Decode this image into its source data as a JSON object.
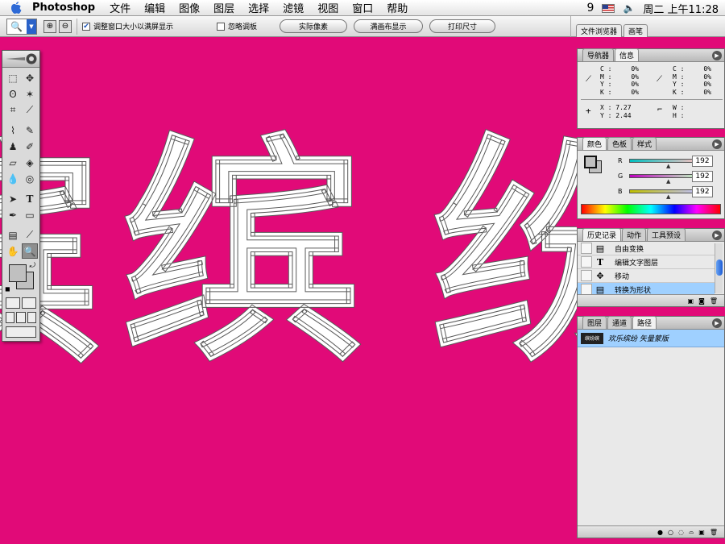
{
  "menubar": {
    "app_name": "Photoshop",
    "items": [
      "文件",
      "编辑",
      "图像",
      "图层",
      "选择",
      "滤镜",
      "视图",
      "窗口",
      "帮助"
    ],
    "status_icon": "9",
    "clock": "周二 上午11:28"
  },
  "options_bar": {
    "resize_windows_label": "调整窗口大小以满屏显示",
    "ignore_palettes_label": "忽略调板",
    "actual_pixels_button": "实际像素",
    "fit_on_screen_button": "满画布显示",
    "print_size_button": "打印尺寸",
    "well_tabs": [
      "文件浏览器",
      "画笔"
    ]
  },
  "canvas": {
    "background_color": "#e10a78",
    "glyphs": [
      "缤",
      "纷",
      "缤"
    ]
  },
  "panels": {
    "navigator": {
      "tabs": [
        "导航器",
        "信息"
      ],
      "cmyk_labels": [
        "C :",
        "M :",
        "Y :",
        "K :"
      ],
      "cmyk_values_left": [
        "0%",
        "0%",
        "0%",
        "0%"
      ],
      "cmyk_values_right": [
        "0%",
        "0%",
        "0%",
        "0%"
      ],
      "x_label": "X :",
      "x_value": "7.27",
      "y_label": "Y :",
      "y_value": "2.44",
      "w_label": "W :",
      "h_label": "H :"
    },
    "color": {
      "tabs": [
        "颜色",
        "色板",
        "样式"
      ],
      "channels": [
        {
          "name": "R",
          "value": "192"
        },
        {
          "name": "G",
          "value": "192"
        },
        {
          "name": "B",
          "value": "192"
        }
      ]
    },
    "history": {
      "tabs": [
        "历史记录",
        "动作",
        "工具预设"
      ],
      "items": [
        "自由变换",
        "编辑文字图层",
        "移动",
        "转换为形状"
      ],
      "selected_index": 3
    },
    "layers": {
      "tabs": [
        "图层",
        "通道",
        "路径"
      ],
      "path_thumb_text": "缤纷缤",
      "path_item": "欢乐缤纷 矢量蒙版"
    }
  }
}
